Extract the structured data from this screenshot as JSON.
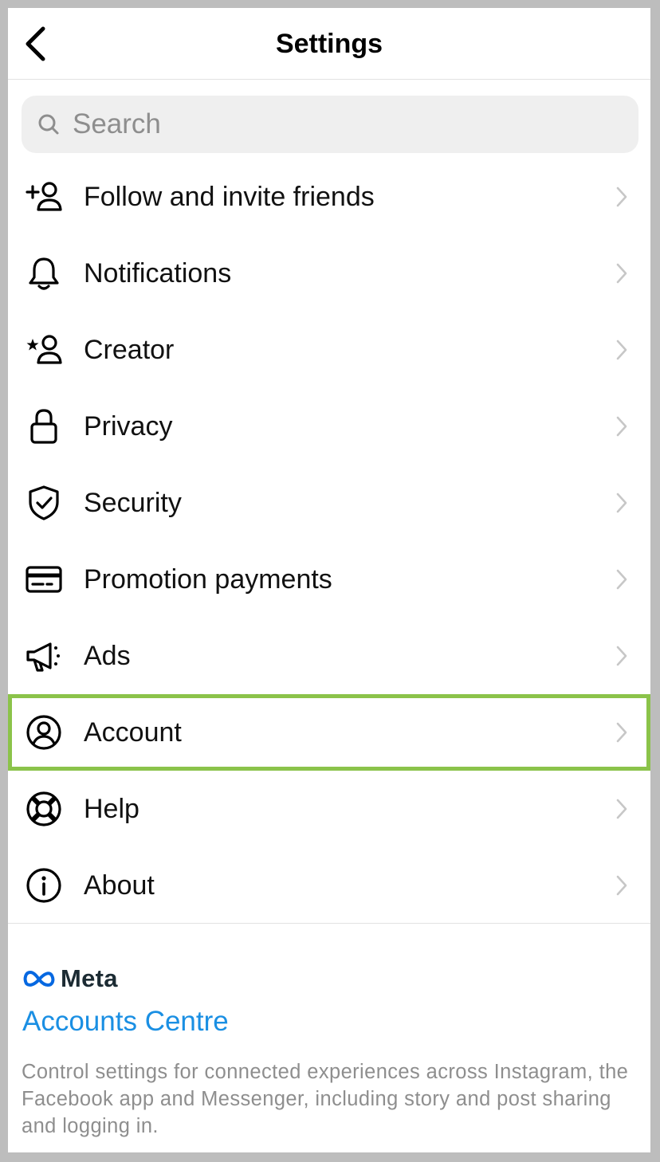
{
  "header": {
    "title": "Settings",
    "back_icon": "back-chevron-icon"
  },
  "search": {
    "placeholder": "Search",
    "value": "",
    "icon": "search-icon"
  },
  "menu": {
    "items": [
      {
        "label": "Follow and invite friends",
        "icon": "add-person-icon"
      },
      {
        "label": "Notifications",
        "icon": "bell-icon"
      },
      {
        "label": "Creator",
        "icon": "creator-star-person-icon"
      },
      {
        "label": "Privacy",
        "icon": "lock-icon"
      },
      {
        "label": "Security",
        "icon": "shield-check-icon"
      },
      {
        "label": "Promotion payments",
        "icon": "card-icon"
      },
      {
        "label": "Ads",
        "icon": "megaphone-icon"
      },
      {
        "label": "Account",
        "icon": "account-circle-icon",
        "highlighted": true
      },
      {
        "label": "Help",
        "icon": "lifebuoy-icon"
      },
      {
        "label": "About",
        "icon": "info-icon"
      }
    ],
    "chevron_icon": "chevron-right-icon"
  },
  "meta_section": {
    "brand": "Meta",
    "brand_icon": "meta-infinity-icon",
    "accounts_centre_label": "Accounts Centre",
    "description": "Control settings for connected experiences across Instagram, the Facebook app and Messenger, including story and post sharing and logging in."
  },
  "colors": {
    "highlight": "#8bc34a",
    "link": "#1a8fe3",
    "search_bg": "#efefef",
    "secondary_text": "#8e8e8e",
    "meta_blue": "#0668e1"
  }
}
